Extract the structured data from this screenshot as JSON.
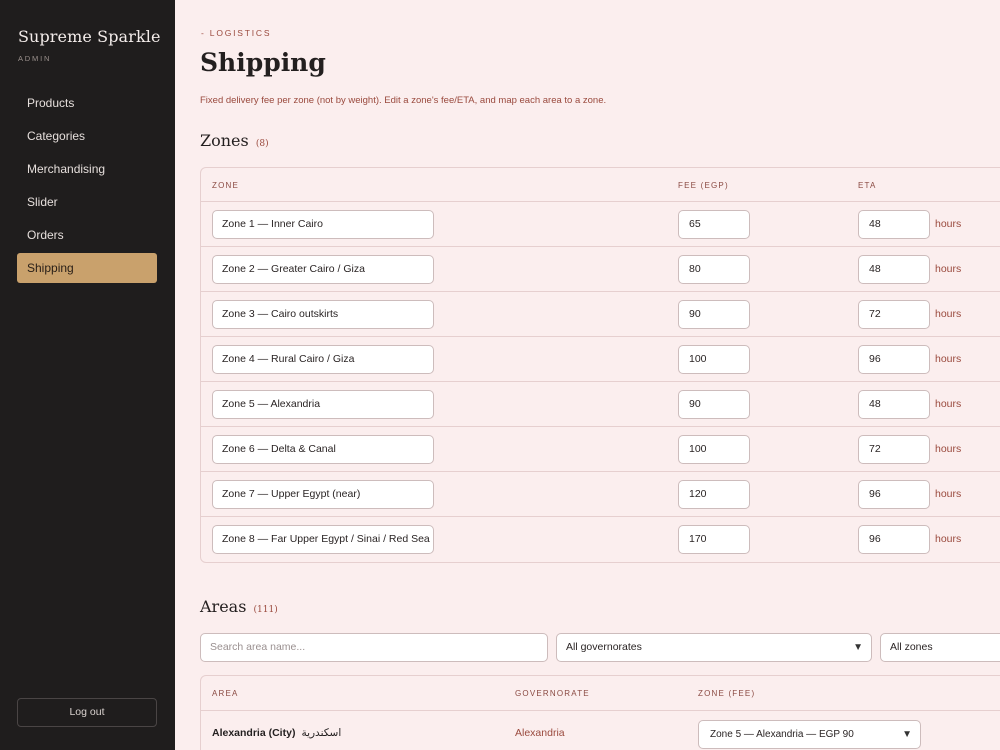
{
  "sidebar": {
    "brand": "Supreme Sparkle",
    "brand_sub": "ADMIN",
    "items": [
      {
        "label": "Products"
      },
      {
        "label": "Categories"
      },
      {
        "label": "Merchandising"
      },
      {
        "label": "Slider"
      },
      {
        "label": "Orders"
      },
      {
        "label": "Shipping",
        "active": true
      }
    ],
    "logout_label": "Log out"
  },
  "header": {
    "eyebrow": "- LOGISTICS",
    "title": "Shipping",
    "description": "Fixed delivery fee per zone (not by weight). Edit a zone's fee/ETA, and map each area to a zone."
  },
  "zones": {
    "title": "Zones",
    "count": "(8)",
    "columns": {
      "zone": "ZONE",
      "fee": "FEE (EGP)",
      "eta": "ETA"
    },
    "unit": "hours",
    "rows": [
      {
        "name": "Zone 1 — Inner Cairo",
        "fee": "65",
        "eta": "48"
      },
      {
        "name": "Zone 2 — Greater Cairo / Giza",
        "fee": "80",
        "eta": "48"
      },
      {
        "name": "Zone 3 — Cairo outskirts",
        "fee": "90",
        "eta": "72"
      },
      {
        "name": "Zone 4 — Rural Cairo / Giza",
        "fee": "100",
        "eta": "96"
      },
      {
        "name": "Zone 5 — Alexandria",
        "fee": "90",
        "eta": "48"
      },
      {
        "name": "Zone 6 — Delta & Canal",
        "fee": "100",
        "eta": "72"
      },
      {
        "name": "Zone 7 — Upper Egypt (near)",
        "fee": "120",
        "eta": "96"
      },
      {
        "name": "Zone 8 — Far Upper Egypt / Sinai / Red Sea",
        "fee": "170",
        "eta": "96"
      }
    ]
  },
  "areas": {
    "title": "Areas",
    "count": "(111)",
    "search_placeholder": "Search area name...",
    "governorate_filter": "All governorates",
    "zone_filter": "All zones",
    "columns": {
      "area": "AREA",
      "governorate": "GOVERNORATE",
      "zone": "ZONE (FEE)"
    },
    "rows": [
      {
        "name": "Alexandria (City)",
        "name_ar": "اسكندرية",
        "governorate": "Alexandria",
        "zone": "Zone 5 — Alexandria — EGP 90"
      }
    ]
  },
  "colors": {
    "sidebar_bg": "#1f1d1d",
    "accent": "#c9a16c",
    "page_bg": "#fbeeee",
    "muted_text": "#9a4a3e"
  }
}
